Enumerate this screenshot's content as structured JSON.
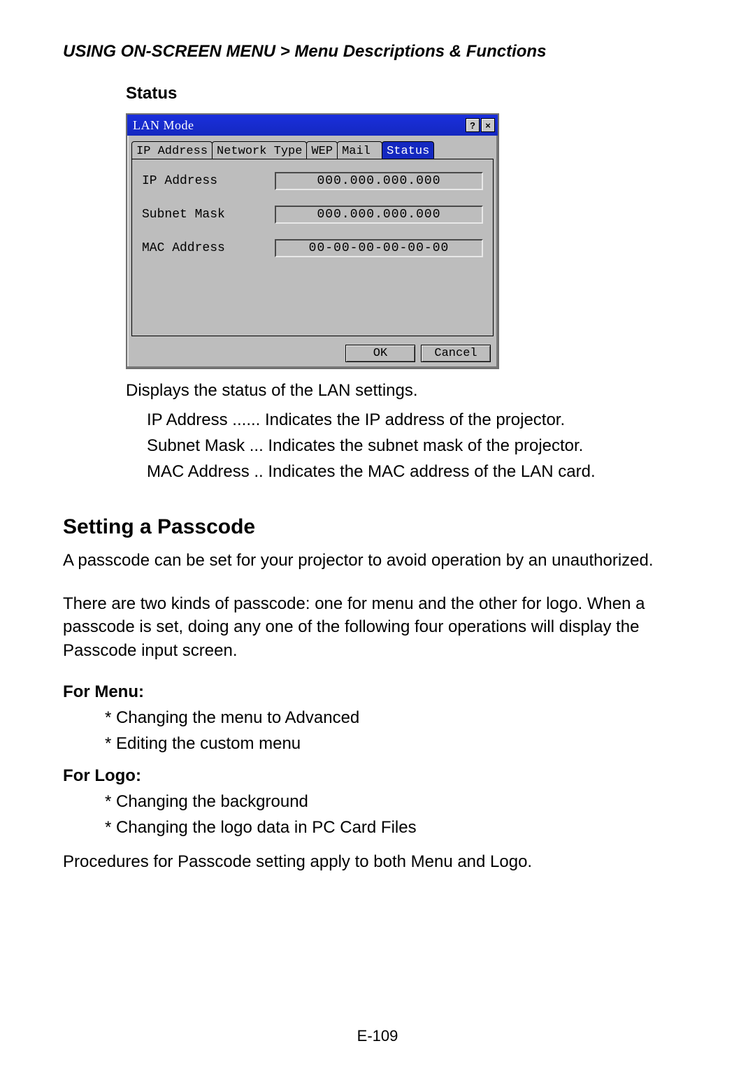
{
  "breadcrumb": {
    "left": "USING ON-SCREEN MENU",
    "sep": ">",
    "right": "Menu Descriptions & Functions"
  },
  "section_label": "Status",
  "dialog": {
    "title": "LAN Mode",
    "help_glyph": "?",
    "close_glyph": "×",
    "tabs": [
      "IP Address",
      "Network Type",
      "WEP",
      "Mail",
      "Status"
    ],
    "selected_tab_index": 4,
    "fields": [
      {
        "label": "IP Address",
        "value": "000.000.000.000"
      },
      {
        "label": "Subnet Mask",
        "value": "000.000.000.000"
      },
      {
        "label": "MAC Address",
        "value": "00-00-00-00-00-00"
      }
    ],
    "ok": "OK",
    "cancel": "Cancel"
  },
  "status_desc": "Displays the status of the LAN settings.",
  "defs": [
    {
      "term": "IP Address",
      "dots": " ...... ",
      "desc": "Indicates the IP address of the projector."
    },
    {
      "term": "Subnet Mask",
      "dots": " ... ",
      "desc": "Indicates the subnet mask of the projector."
    },
    {
      "term": "MAC Address",
      "dots": " .. ",
      "desc": "Indicates the MAC address of the LAN card."
    }
  ],
  "h2": "Setting a Passcode",
  "para1": "A passcode can be set for your projector to avoid operation by an unauthorized.",
  "para2": "There are two kinds of passcode: one for menu and the other for logo. When a passcode is set, doing any one of the following four operations will display the Passcode input screen.",
  "for_menu_label": "For Menu:",
  "for_menu_items": [
    "Changing the menu to Advanced",
    "Editing the custom menu"
  ],
  "for_logo_label": "For Logo:",
  "for_logo_items": [
    "Changing the background",
    "Changing the logo data in PC Card Files"
  ],
  "closing": "Procedures for Passcode setting apply to both Menu and Logo.",
  "page_number": "E-109"
}
